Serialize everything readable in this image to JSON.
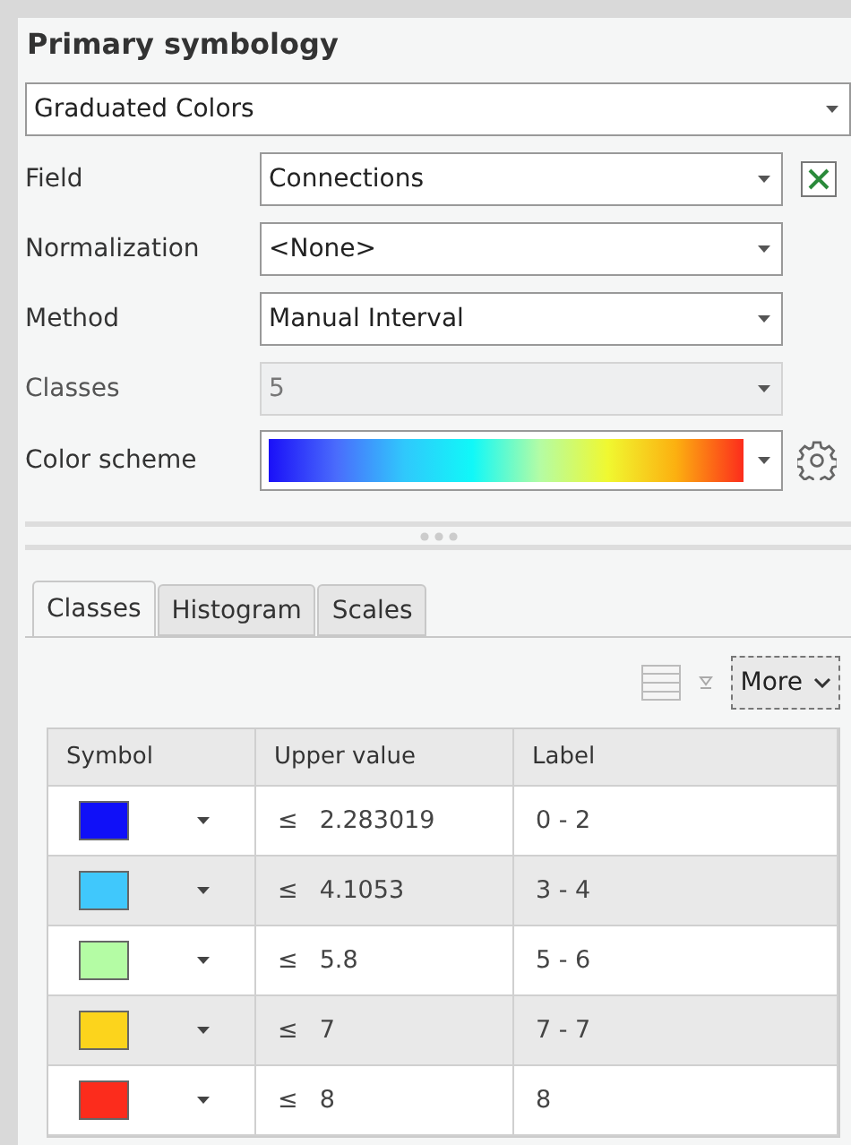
{
  "title": "Primary symbology",
  "renderer": {
    "value": "Graduated Colors"
  },
  "fields": [
    {
      "label": "Field",
      "kind": "dropdown",
      "value": "Connections",
      "disabled": false,
      "expression_button": true
    },
    {
      "label": "Normalization",
      "kind": "dropdown",
      "value": "<None>",
      "disabled": false
    },
    {
      "label": "Method",
      "kind": "dropdown",
      "value": "Manual Interval",
      "disabled": false
    },
    {
      "label": "Classes",
      "kind": "dropdown",
      "value": "5",
      "disabled": true
    },
    {
      "label": "Color scheme",
      "kind": "ramp",
      "disabled": false,
      "settings_button": true
    }
  ],
  "tabs": [
    {
      "label": "Classes",
      "selected": true
    },
    {
      "label": "Histogram",
      "selected": false
    },
    {
      "label": "Scales",
      "selected": false
    }
  ],
  "toolbar": {
    "more_button": "More"
  },
  "table": {
    "columns": [
      "Symbol",
      "Upper value",
      "Label"
    ],
    "rows": [
      {
        "color": "#1010f8",
        "operator": "≤",
        "upper": "2.283019",
        "label": "0 - 2"
      },
      {
        "color": "#40c8fc",
        "operator": "≤",
        "upper": "4.1053",
        "label": "3 - 4"
      },
      {
        "color": "#b4fca4",
        "operator": "≤",
        "upper": "5.8",
        "label": "5 - 6"
      },
      {
        "color": "#fcd41c",
        "operator": "≤",
        "upper": "7",
        "label": "7 - 7"
      },
      {
        "color": "#fc2c1c",
        "operator": "≤",
        "upper": "8",
        "label": "8"
      }
    ]
  }
}
